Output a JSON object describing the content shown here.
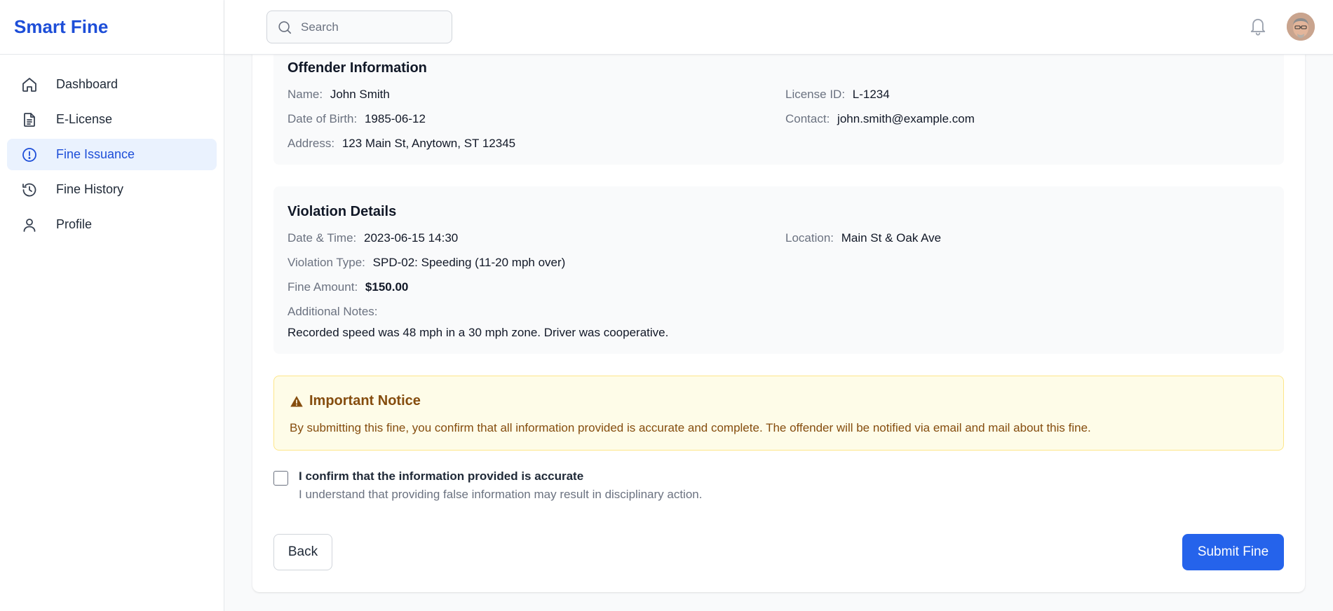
{
  "app": {
    "brand": "Smart Fine"
  },
  "sidebar": {
    "items": [
      {
        "label": "Dashboard",
        "icon": "home-icon",
        "active": false
      },
      {
        "label": "E-License",
        "icon": "document-icon",
        "active": false
      },
      {
        "label": "Fine Issuance",
        "icon": "alert-circle-icon",
        "active": true
      },
      {
        "label": "Fine History",
        "icon": "history-icon",
        "active": false
      },
      {
        "label": "Profile",
        "icon": "user-icon",
        "active": false
      }
    ]
  },
  "header": {
    "search_placeholder": "Search",
    "notification_icon": "bell-icon",
    "avatar_icon": "user-avatar"
  },
  "offender": {
    "title": "Offender Information",
    "name_label": "Name:",
    "name": "John Smith",
    "license_label": "License ID:",
    "license": "L-1234",
    "dob_label": "Date of Birth:",
    "dob": "1985-06-12",
    "contact_label": "Contact:",
    "contact": "john.smith@example.com",
    "address_label": "Address:",
    "address": "123 Main St, Anytown, ST 12345"
  },
  "violation": {
    "title": "Violation Details",
    "datetime_label": "Date & Time:",
    "datetime": "2023-06-15 14:30",
    "location_label": "Location:",
    "location": "Main St & Oak Ave",
    "type_label": "Violation Type:",
    "type": "SPD-02: Speeding (11-20 mph over)",
    "amount_label": "Fine Amount:",
    "amount": "$150.00",
    "notes_label": "Additional Notes:",
    "notes": "Recorded speed was 48 mph in a 30 mph zone. Driver was cooperative."
  },
  "notice": {
    "title": "Important Notice",
    "icon": "warning-icon",
    "text": "By submitting this fine, you confirm that all information provided is accurate and complete. The offender will be notified via email and mail about this fine."
  },
  "confirm": {
    "checked": false,
    "title": "I confirm that the information provided is accurate",
    "subtitle": "I understand that providing false information may result in disciplinary action."
  },
  "actions": {
    "back_label": "Back",
    "submit_label": "Submit Fine"
  },
  "colors": {
    "brand": "#1d4ed8",
    "primary_button": "#2563eb",
    "active_nav_bg": "#eaf2fe",
    "notice_bg": "#fefce8",
    "notice_text": "#854d0e"
  }
}
